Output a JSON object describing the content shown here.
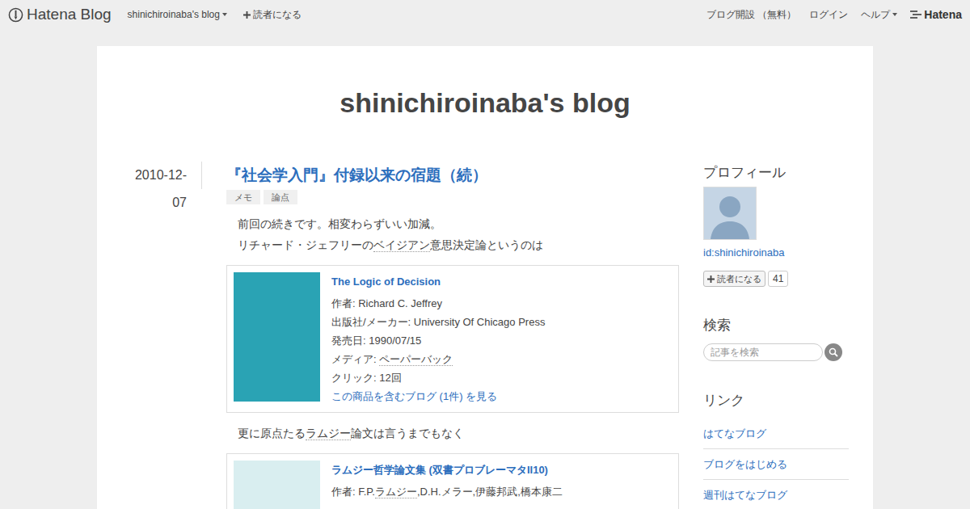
{
  "topbar": {
    "logo": "Hatena Blog",
    "blog_menu": "shinichiroinaba's blog",
    "subscribe": "読者になる",
    "right_links": [
      {
        "label": "ブログ開設 （無料）",
        "dropdown": false
      },
      {
        "label": "ログイン",
        "dropdown": false
      },
      {
        "label": "ヘルプ",
        "dropdown": true
      }
    ],
    "hatena_logo": "Hatena"
  },
  "blog_title": "shinichiroinaba's blog",
  "entry": {
    "date": "2010-12-07",
    "title": "『社会学入門』付録以来の宿題（続）",
    "tags": [
      "メモ",
      "論点"
    ],
    "blocks": [
      {
        "kind": "paragraph",
        "segments": [
          {
            "text": "前回の続きです。相変わらずいい加減。",
            "keyword": false
          }
        ]
      },
      {
        "kind": "paragraph",
        "segments": [
          {
            "text": "リチャード・ジェフリーの",
            "keyword": false
          },
          {
            "text": "ベイジアン",
            "keyword": true
          },
          {
            "text": "意思決定論というのは",
            "keyword": false
          }
        ]
      },
      {
        "kind": "product",
        "title": "The Logic of Decision",
        "cover_color": "#2aa3b4",
        "rows": [
          [
            {
              "text": "作者: Richard C. Jeffrey",
              "keyword": false
            }
          ],
          [
            {
              "text": "出版社/メーカー: University Of Chicago Press",
              "keyword": false
            }
          ],
          [
            {
              "text": "発売日: 1990/07/15",
              "keyword": false
            }
          ],
          [
            {
              "text": "メディア: ",
              "keyword": false
            },
            {
              "text": "ペーパーバック",
              "keyword": true
            }
          ],
          [
            {
              "text": "クリック: 12回",
              "keyword": false
            }
          ]
        ],
        "link": "この商品を含むブログ (1件) を見る"
      },
      {
        "kind": "paragraph",
        "segments": [
          {
            "text": "更に原点たる",
            "keyword": false
          },
          {
            "text": "ラムジー",
            "keyword": true
          },
          {
            "text": "論文は言うまでもなく",
            "keyword": false
          }
        ]
      },
      {
        "kind": "product",
        "title": "ラムジー哲学論文集 (双書プロブレーマタII10)",
        "cover_color": "#d9eef0",
        "rows": [
          [
            {
              "text": "作者: F.P.",
              "keyword": false
            },
            {
              "text": "ラムジー",
              "keyword": true
            },
            {
              "text": ",D.H.メラー,伊藤邦武,橋本康二",
              "keyword": false
            }
          ]
        ],
        "link": ""
      }
    ]
  },
  "sidebar": {
    "profile": {
      "heading": "プロフィール",
      "id": "id:shinichiroinaba",
      "subscribe": "読者になる",
      "count": "41"
    },
    "search": {
      "heading": "検索",
      "placeholder": "記事を検索"
    },
    "links": {
      "heading": "リンク",
      "items": [
        "はてなブログ",
        "ブログをはじめる",
        "週刊はてなブログ"
      ]
    }
  }
}
